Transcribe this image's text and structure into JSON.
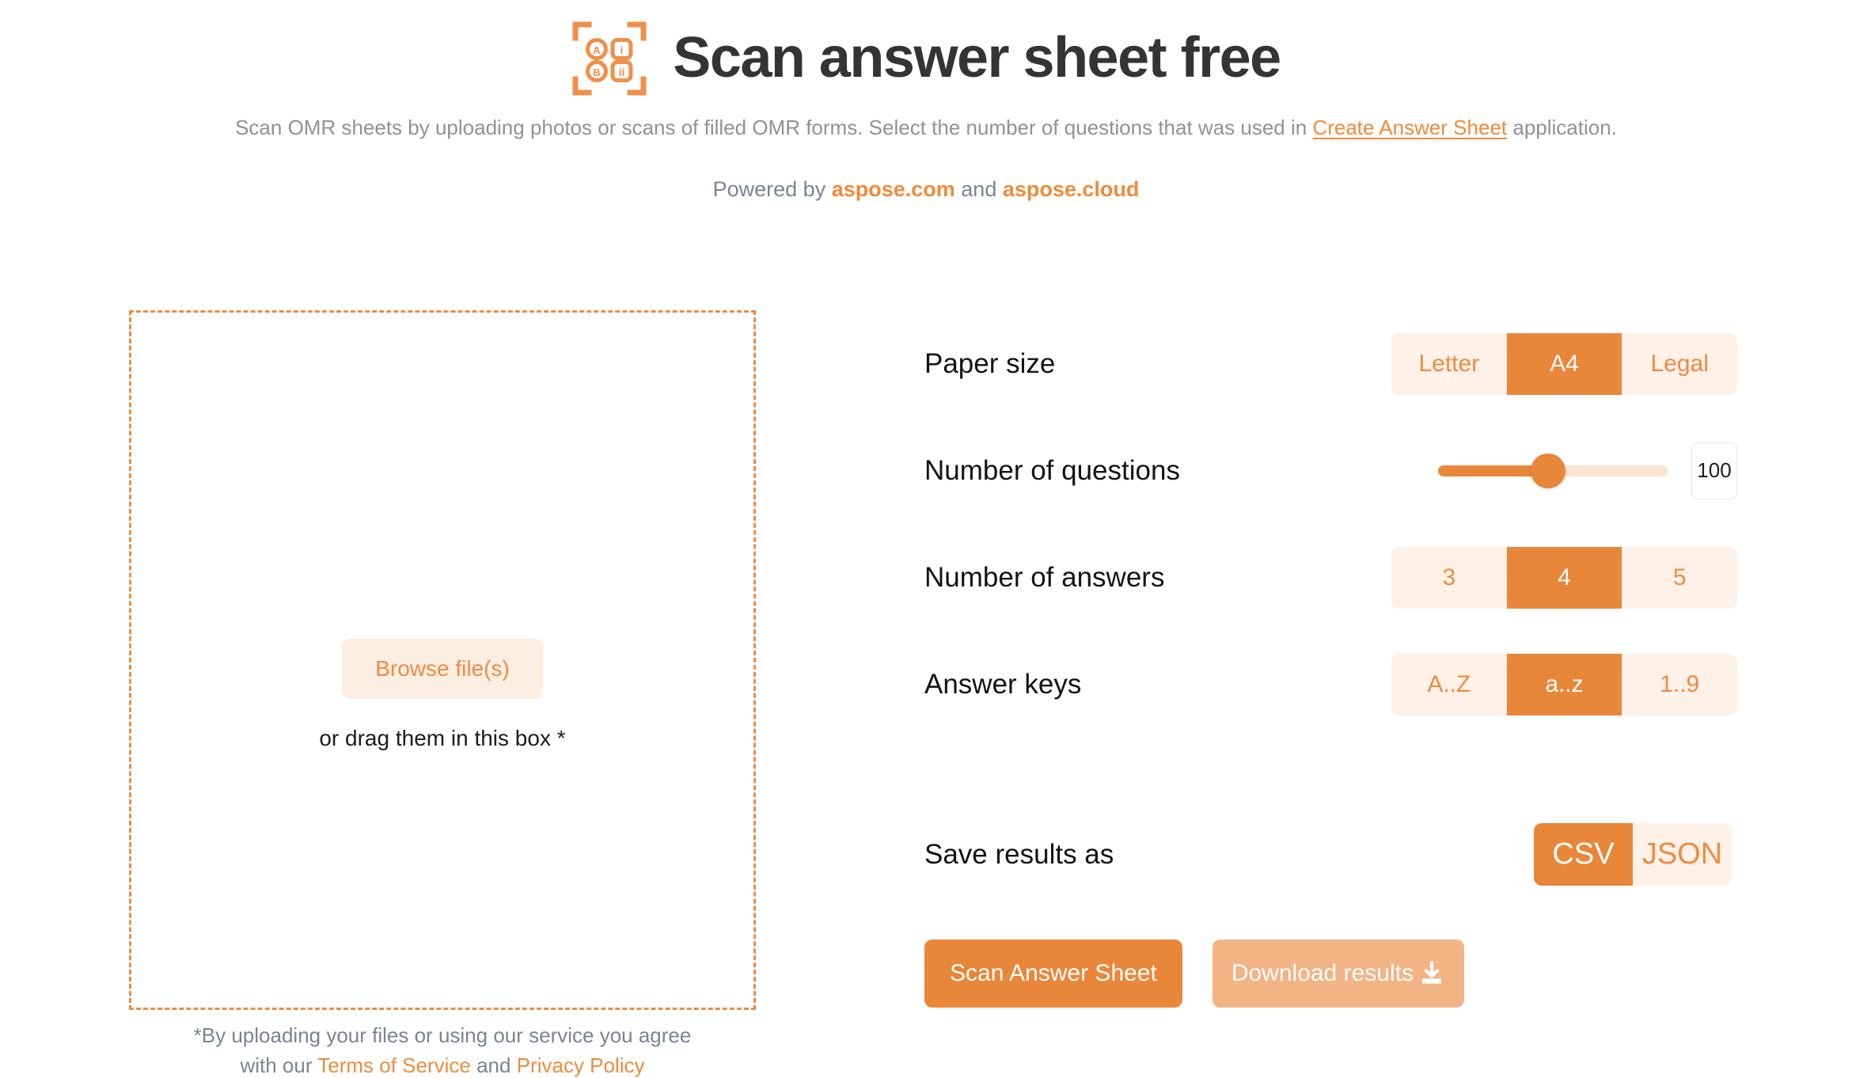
{
  "header": {
    "logo_icon": "omr-scan-frame-icon",
    "logo_cells": [
      "A",
      "i",
      "B",
      "ii"
    ],
    "title": "Scan answer sheet free",
    "subtitle_before": "Scan OMR sheets by uploading photos or scans of filled OMR forms. Select the number of questions that was used in ",
    "subtitle_link": "Create Answer Sheet",
    "subtitle_after": " application.",
    "powered_prefix": "Powered by ",
    "powered_link1": "aspose.com",
    "powered_middle": " and ",
    "powered_link2": "aspose.cloud"
  },
  "dropzone": {
    "browse_label": "Browse file(s)",
    "drag_label": "or drag them in this box *"
  },
  "terms": {
    "line1": "*By uploading your files or using our service you agree",
    "line2_prefix": "with our ",
    "link_terms": "Terms of Service",
    "line2_middle": " and ",
    "link_privacy": "Privacy Policy"
  },
  "settings": {
    "paper_size": {
      "label": "Paper size",
      "options": [
        "Letter",
        "A4",
        "Legal"
      ],
      "selected": "A4"
    },
    "number_of_questions": {
      "label": "Number of questions",
      "value": "100",
      "slider_percent": 48
    },
    "number_of_answers": {
      "label": "Number of answers",
      "options": [
        "3",
        "4",
        "5"
      ],
      "selected": "4"
    },
    "answer_keys": {
      "label": "Answer keys",
      "options": [
        "A..Z",
        "a..z",
        "1..9"
      ],
      "selected": "a..z"
    },
    "save_results_as": {
      "label": "Save results as",
      "options": [
        "CSV",
        "JSON"
      ],
      "selected": "CSV"
    }
  },
  "actions": {
    "scan_label": "Scan Answer Sheet",
    "download_label": "Download results",
    "download_icon": "download-icon"
  },
  "colors": {
    "accent": "#e8863a",
    "accent_light": "#fdf1e8",
    "accent_text": "#ee8c40",
    "muted": "#7b8490",
    "disabled": "#f2b385"
  }
}
